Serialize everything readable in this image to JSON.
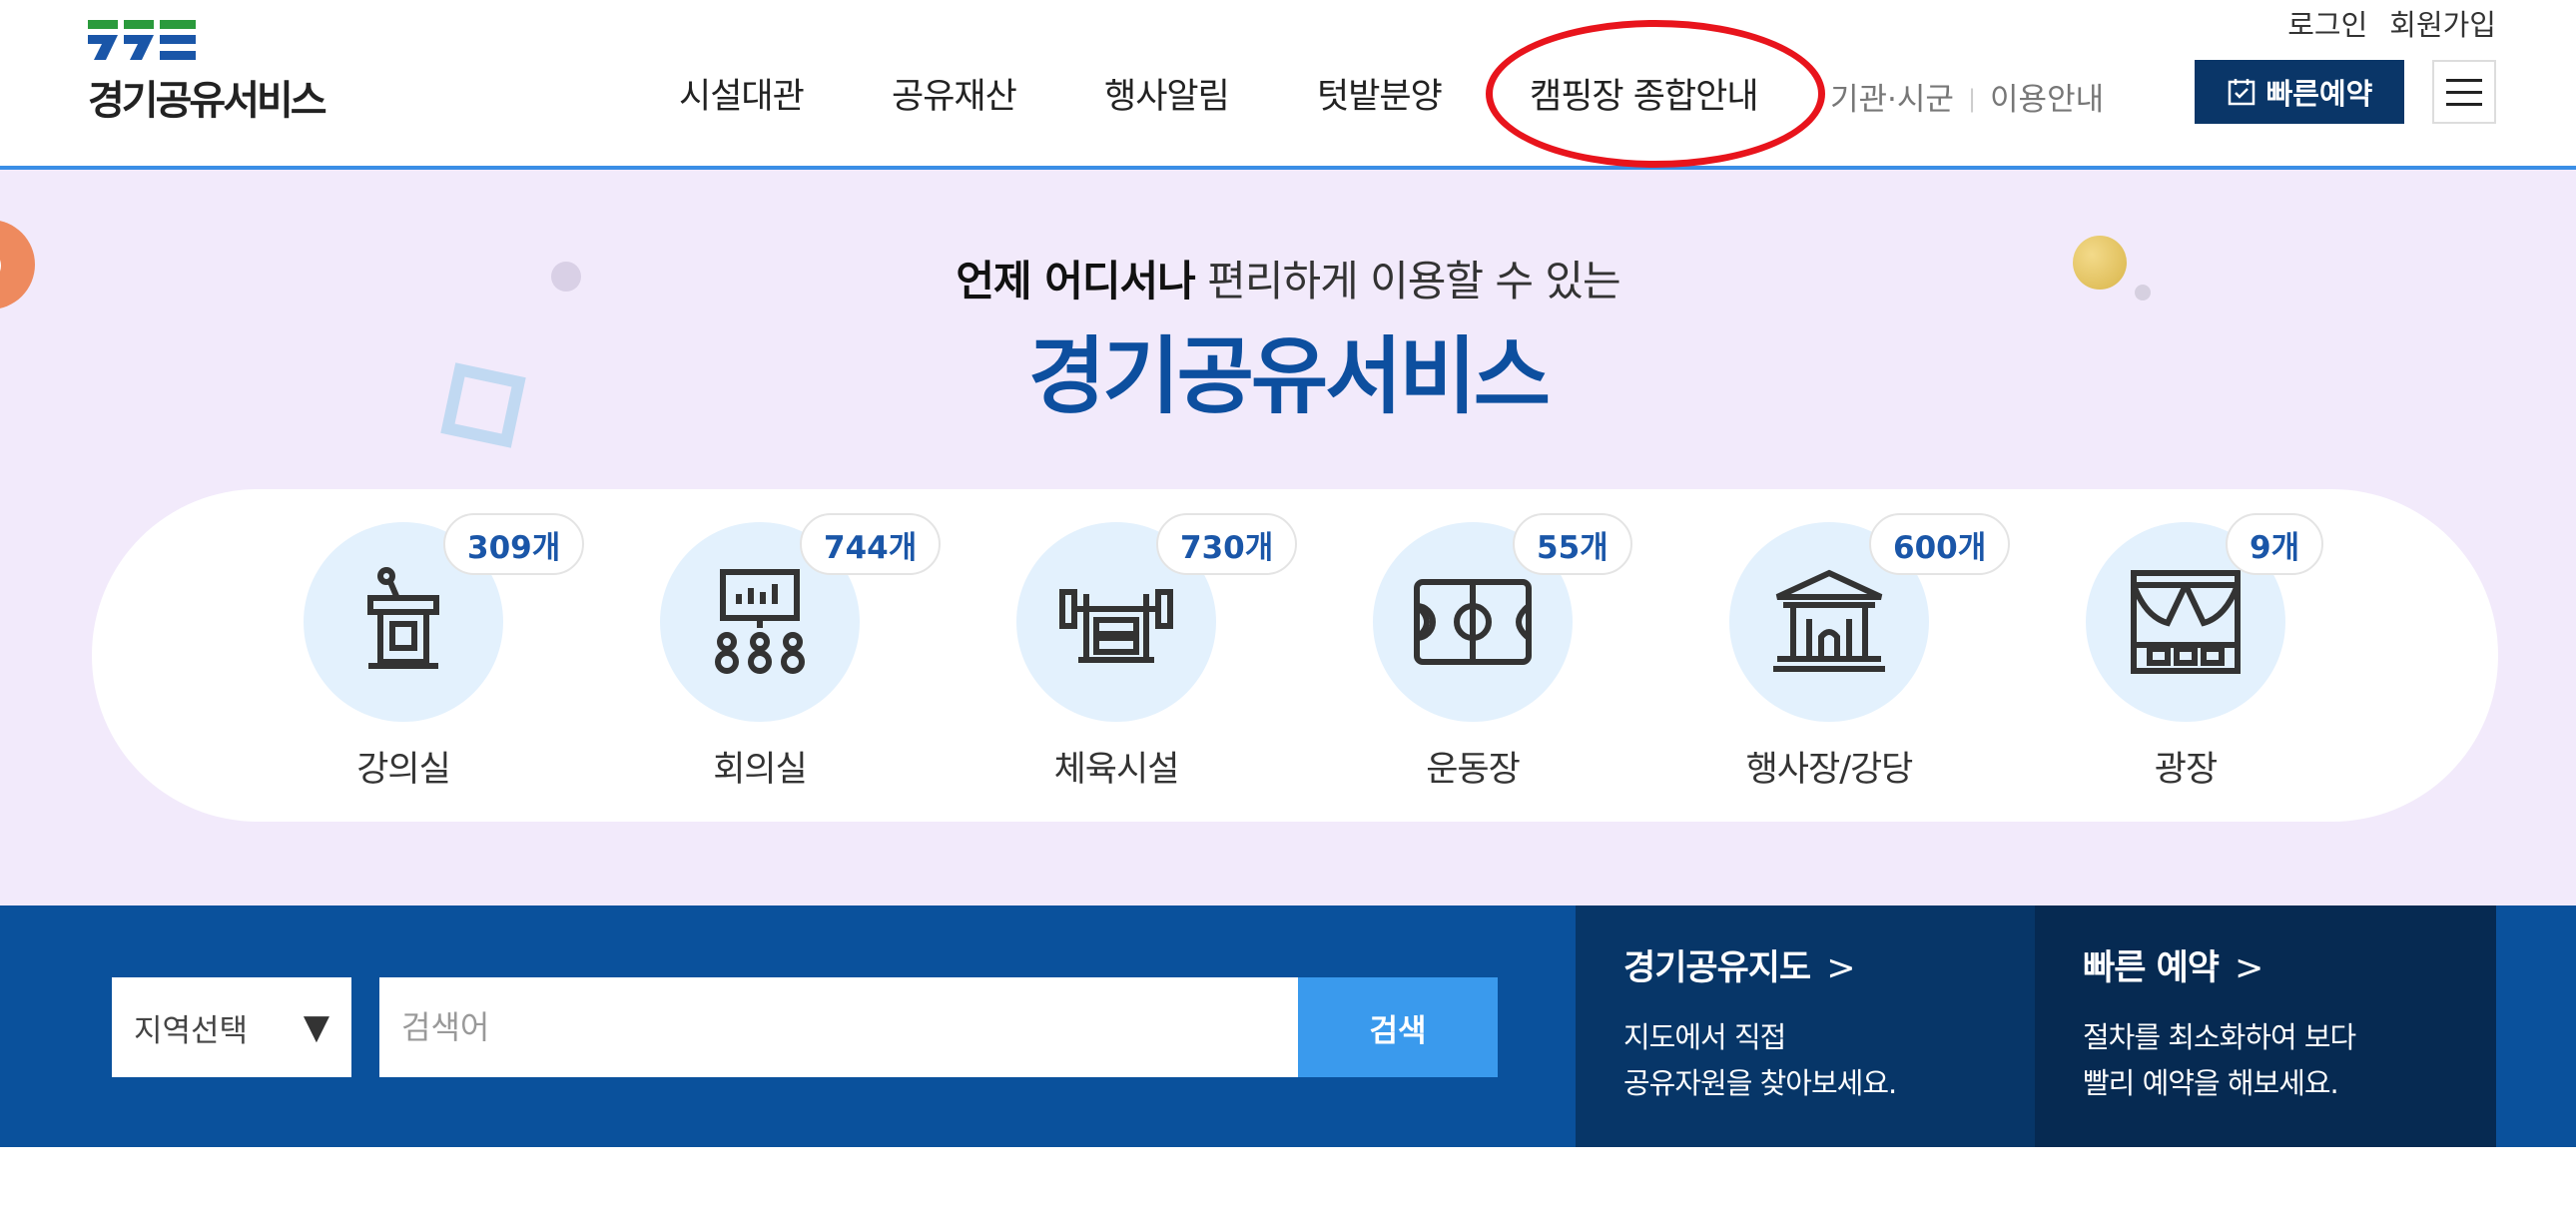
{
  "header": {
    "logo_text": "경기공유서비스",
    "util": {
      "login": "로그인",
      "signup": "회원가입"
    },
    "nav": [
      "시설대관",
      "공유재산",
      "행사알림",
      "텃밭분양",
      "캠핑장 종합안내"
    ],
    "sub_links": {
      "agencies": "기관·시군",
      "guide": "이용안내"
    },
    "quick_reserve_label": "빠른예약"
  },
  "hero": {
    "subtitle_bold": "언제 어디서나",
    "subtitle_rest": " 편리하게 이용할 수 있는",
    "title": "경기공유서비스",
    "categories": [
      {
        "label": "강의실",
        "count": "309개",
        "icon": "lectern-icon"
      },
      {
        "label": "회의실",
        "count": "744개",
        "icon": "meeting-board-icon"
      },
      {
        "label": "체육시설",
        "count": "730개",
        "icon": "gym-equipment-icon"
      },
      {
        "label": "운동장",
        "count": "55개",
        "icon": "sports-field-icon"
      },
      {
        "label": "행사장/강당",
        "count": "600개",
        "icon": "auditorium-icon"
      },
      {
        "label": "광장",
        "count": "9개",
        "icon": "stage-icon"
      }
    ]
  },
  "search": {
    "region_select": "지역선택",
    "placeholder": "검색어",
    "button_label": "검색"
  },
  "panels": {
    "map": {
      "title": "경기공유지도",
      "desc_line1": "지도에서 직접",
      "desc_line2": "공유자원을 찾아보세요."
    },
    "quick": {
      "title": "빠른 예약",
      "desc_line1": "절차를 최소화하여 보다",
      "desc_line2": "빨리 예약을 해보세요."
    }
  },
  "colors": {
    "brand_navy": "#0a3668",
    "hero_title": "#0d4f9f",
    "search_band": "#0a519c",
    "search_button": "#3a9aed",
    "highlight": "#e8141c"
  }
}
